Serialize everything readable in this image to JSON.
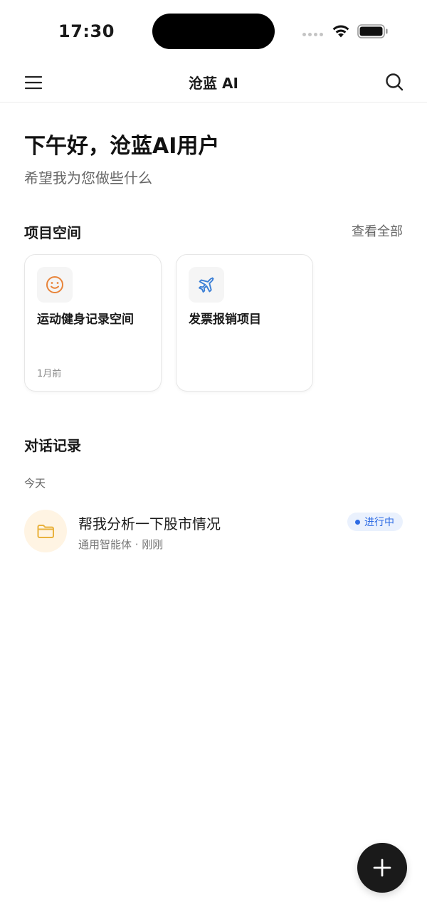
{
  "status_bar": {
    "time": "17:30"
  },
  "nav": {
    "title": "沧蓝 AI",
    "menu_icon": "menu-icon",
    "search_icon": "search-icon"
  },
  "greeting": {
    "title": "下午好，沧蓝AI用户",
    "subtitle": "希望我为您做些什么"
  },
  "projects": {
    "title": "项目空间",
    "view_all": "查看全部",
    "items": [
      {
        "title": "运动健身记录空间",
        "time": "1月前",
        "icon": "smiley-icon",
        "icon_color": "#e8843a"
      },
      {
        "title": "发票报销项目",
        "time": "",
        "icon": "airplane-icon",
        "icon_color": "#3b7fd6"
      }
    ]
  },
  "conversations": {
    "title": "对话记录",
    "groups": [
      {
        "label": "今天",
        "items": [
          {
            "title": "帮我分析一下股市情况",
            "meta": "通用智能体 · 刚刚",
            "status": "进行中",
            "icon": "folder-icon",
            "icon_color": "#e9b23e"
          }
        ]
      }
    ]
  },
  "fab": {
    "icon": "plus-icon"
  },
  "colors": {
    "accent_blue": "#2d6be4",
    "badge_bg": "#eaf1fd",
    "fab_bg": "#1a1a1a",
    "avatar_bg": "#fff4e3"
  }
}
